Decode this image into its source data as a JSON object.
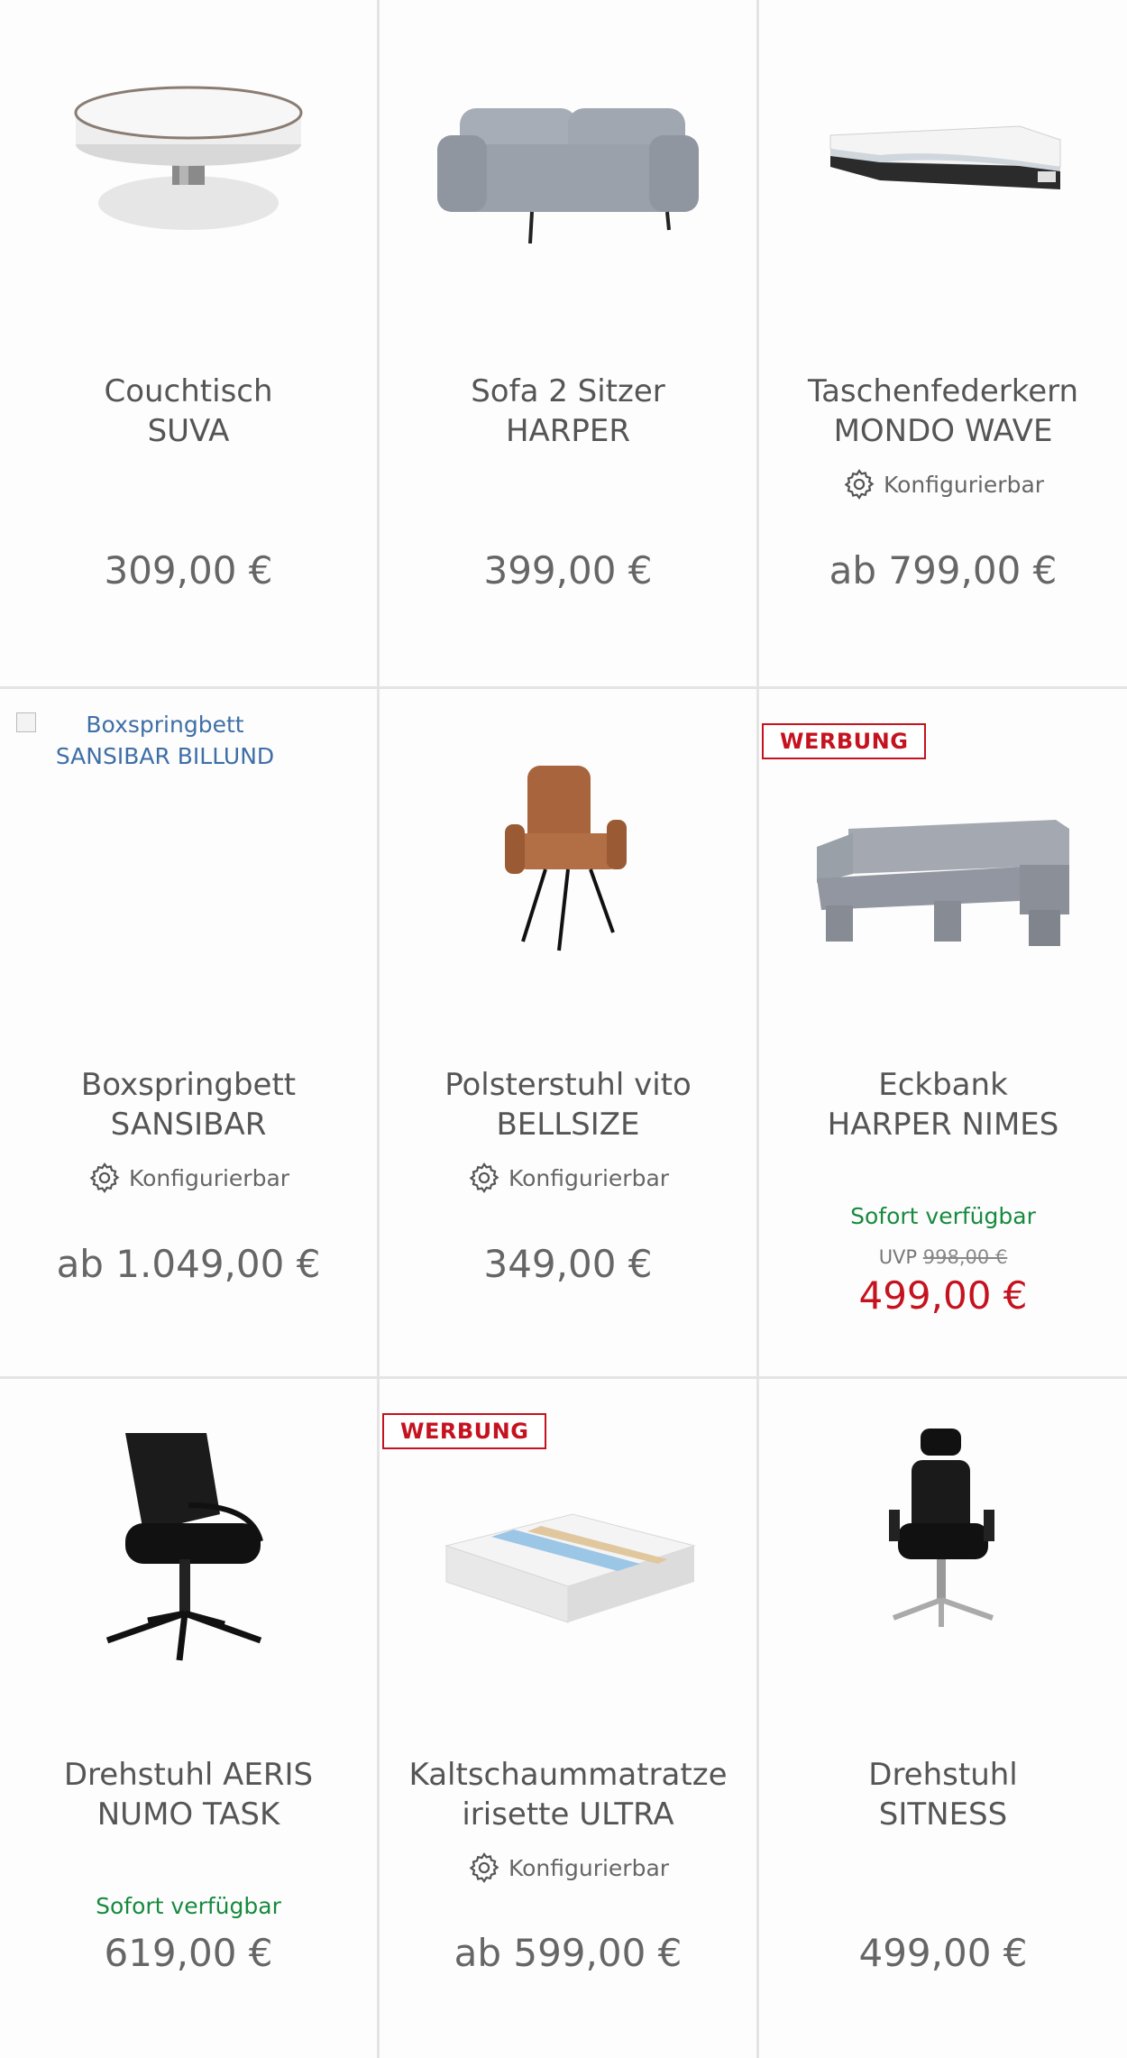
{
  "products": [
    {
      "line1": "Couchtisch",
      "line2": "SUVA",
      "price": "309,00 €"
    },
    {
      "line1": "Sofa 2 Sitzer",
      "line2": "HARPER",
      "price": "399,00 €"
    },
    {
      "line1": "Taschenfederkern",
      "line2": "MONDO WAVE",
      "config": "Konfigurierbar",
      "price": "ab 799,00 €"
    },
    {
      "alt_line1": "Boxspringbett",
      "alt_line2": "SANSIBAR BILLUND",
      "line1": "Boxspringbett",
      "line2": "SANSIBAR",
      "config": "Konfigurierbar",
      "price": "ab 1.049,00 €"
    },
    {
      "line1": "Polsterstuhl vito",
      "line2": "BELLSIZE",
      "config": "Konfigurierbar",
      "price": "349,00 €"
    },
    {
      "badge": "WERBUNG",
      "line1": "Eckbank",
      "line2": "HARPER NIMES",
      "availability": "Sofort verfügbar",
      "uvp_label": "UVP",
      "uvp_price": "998,00 €",
      "price": "499,00 €"
    },
    {
      "line1": "Drehstuhl AERIS",
      "line2": "NUMO TASK",
      "availability": "Sofort verfügbar",
      "price": "619,00 €"
    },
    {
      "badge": "WERBUNG",
      "line1": "Kaltschaummatratze",
      "line2": "irisette ULTRA",
      "config": "Konfigurierbar",
      "price": "ab 599,00 €"
    },
    {
      "line1": "Drehstuhl",
      "line2": "SITNESS",
      "price": "499,00 €"
    }
  ],
  "icons": {
    "config": "gear-icon",
    "broken_image": "broken-image-icon"
  },
  "colors": {
    "sale": "#c5121f",
    "availability": "#178a3e",
    "badge": "#c5121f",
    "alt_link": "#3e6fa6"
  }
}
